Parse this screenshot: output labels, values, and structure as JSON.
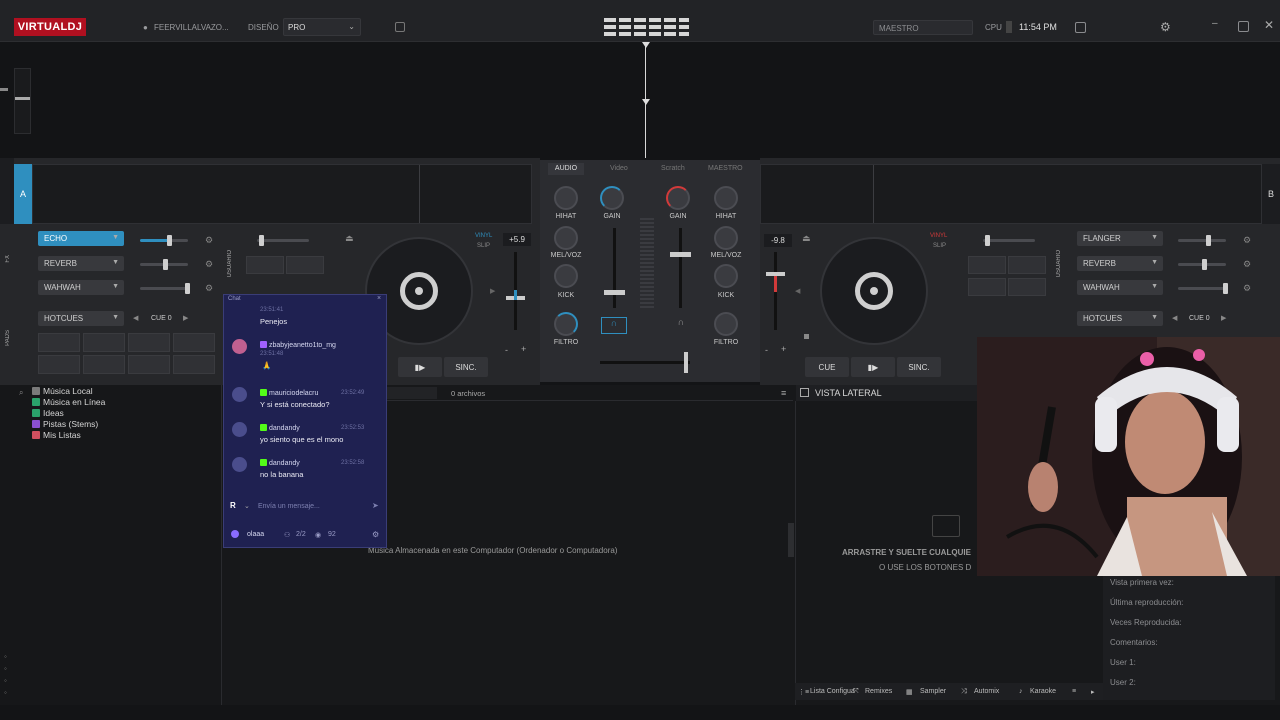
{
  "app": {
    "logo_prefix": "VIRTUAL",
    "logo_suffix": "DJ"
  },
  "topbar": {
    "user": "FEERVILLALVAZO...",
    "design_label": "DISEÑO",
    "design_value": "PRO",
    "master_label": "MAESTRO",
    "cpu_label": "CPU",
    "time": "11:54 PM"
  },
  "mixer": {
    "tabs": [
      "AUDIO",
      "Video",
      "Scratch",
      "MAESTRO"
    ],
    "left_labels": [
      "HIHAT",
      "MEL/VOZ",
      "KICK",
      "FILTRO"
    ],
    "right_labels": [
      "HIHAT",
      "MEL/VOZ",
      "KICK",
      "FILTRO"
    ],
    "gain_label": "GAIN"
  },
  "deck_left": {
    "letter": "A",
    "fx": [
      "ECHO",
      "REVERB",
      "WAHWAH"
    ],
    "pads_label": "HOTCUES",
    "cue_label": "CUE 0",
    "pitch": "+5.9",
    "vinyl": "VINYL",
    "slip": "SLIP",
    "sync": "SINC.",
    "side_label": "USUARIO",
    "fx_side": "FX",
    "pads_side": "PADS"
  },
  "deck_right": {
    "letter": "B",
    "fx": [
      "FLANGER",
      "REVERB",
      "WAHWAH"
    ],
    "pads_label": "HOTCUES",
    "cue_label": "CUE 0",
    "pitch": "-9.8",
    "vinyl": "VINYL",
    "slip": "SLIP",
    "cue": "CUE",
    "sync": "SINC.",
    "side_label": "USUARIO"
  },
  "browser": {
    "tree": [
      {
        "label": "Música Local",
        "color": "#7a7a7a"
      },
      {
        "label": "Música en Línea",
        "color": "#2aa36b"
      },
      {
        "label": "Ideas",
        "color": "#2aa36b"
      },
      {
        "label": "Pistas (Stems)",
        "color": "#8a4fd0"
      },
      {
        "label": "Mis Listas",
        "color": "#d04f5f"
      }
    ],
    "file_count": "0 archivos",
    "empty_message": "Música Almacenada en este Computador (Ordenador o Computadora)",
    "side_panel_title": "VISTA LATERAL",
    "drop_line1": "ARRASTRE Y SUELTE CUALQUIE",
    "drop_line2": "O USE LOS BOTONES D"
  },
  "chat": {
    "header": "Chat",
    "messages": [
      {
        "user": "",
        "time": "23:51:41",
        "text": "Penejos"
      },
      {
        "user": "zbabyjeanetto1to_mg",
        "time": "23:51:48",
        "text": "🙏"
      },
      {
        "user": "mauriciodelacru",
        "time": "23:52:49",
        "text": "Y si está conectado?"
      },
      {
        "user": "dandandy",
        "time": "23:52:53",
        "text": "yo siento que es el mono"
      },
      {
        "user": "dandandy",
        "time": "23:52:58",
        "text": "no la banana"
      }
    ],
    "input_placeholder": "Envía un mensaje...",
    "footer_name": "olaaa",
    "footer_count": "2/2",
    "footer_viewers": "92"
  },
  "sideinfo": {
    "lines": [
      "Vista primera vez:",
      "Última reproducción:",
      "Veces Reproducida:",
      "Comentarios:",
      "User 1:",
      "User 2:"
    ]
  },
  "bottombar": {
    "tabs": [
      "Lista Configua",
      "Remixes",
      "Sampler",
      "Automix",
      "Karaoke"
    ]
  },
  "colors": {
    "accent": "#2f8fbf",
    "brand": "#b01020",
    "chat_bg": "#1f2151"
  }
}
